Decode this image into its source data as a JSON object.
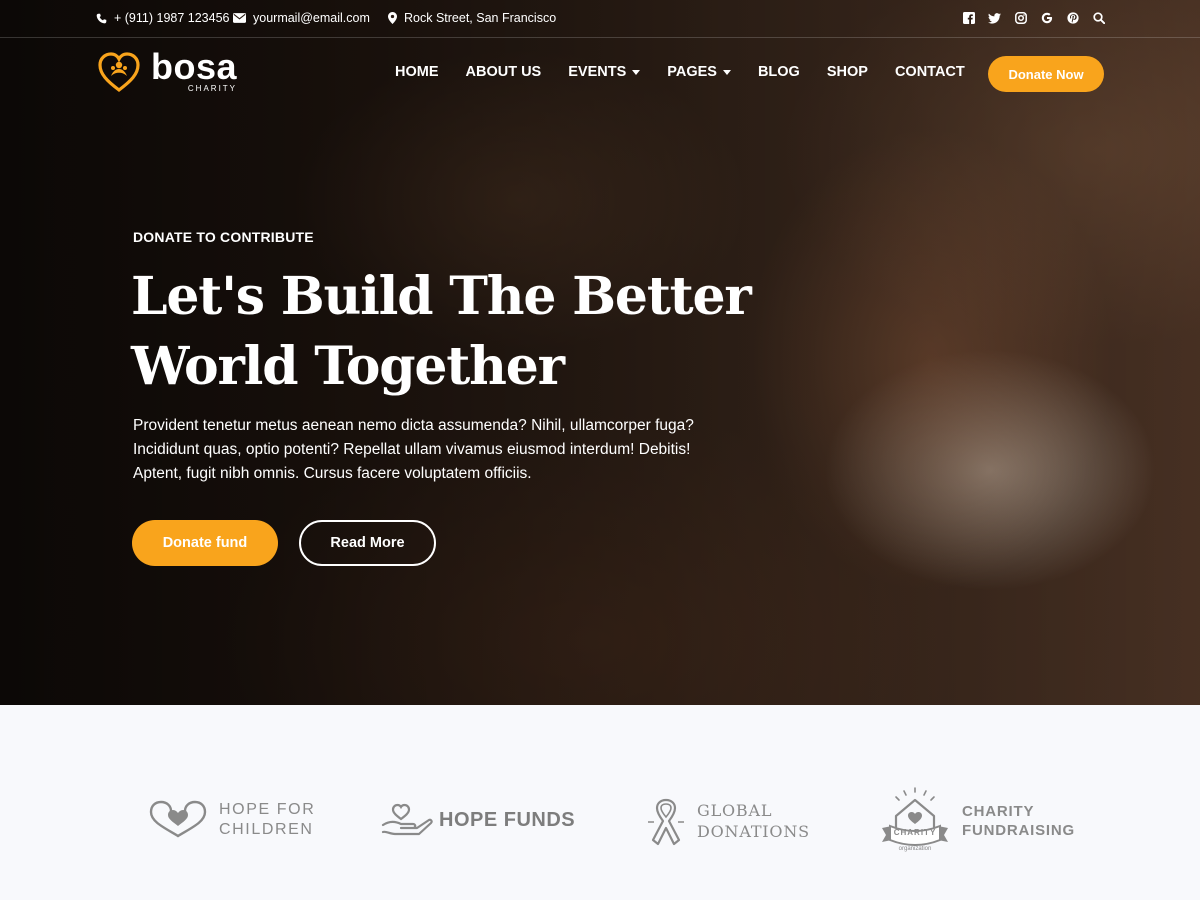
{
  "topbar": {
    "phone": "+ (911) 1987 123456",
    "email": "yourmail@email.com",
    "address": "Rock Street, San Francisco",
    "social": [
      "facebook-icon",
      "twitter-icon",
      "instagram-icon",
      "google-icon",
      "pinterest-icon",
      "search-icon"
    ]
  },
  "logo": {
    "name": "bosa",
    "tagline": "CHARITY"
  },
  "nav": {
    "items": [
      {
        "label": "HOME"
      },
      {
        "label": "ABOUT US"
      },
      {
        "label": "EVENTS"
      },
      {
        "label": "PAGES"
      },
      {
        "label": "BLOG"
      },
      {
        "label": "SHOP"
      },
      {
        "label": "CONTACT"
      }
    ],
    "cta": "Donate Now"
  },
  "hero": {
    "eyebrow": "DONATE TO CONTRIBUTE",
    "title_line1": "Let's Build The Better",
    "title_line2": "World Together",
    "desc_line1": "Provident tenetur metus aenean nemo dicta assumenda? Nihil, ullamcorper fuga?",
    "desc_line2": "Incididunt quas, optio potenti? Repellat ullam vivamus eiusmod interdum! Debitis!",
    "desc_line3": "Aptent, fugit nibh omnis. Cursus facere voluptatem officiis.",
    "primary_button": "Donate fund",
    "secondary_button": "Read More"
  },
  "partners": {
    "p1": {
      "line1": "HOPE FOR",
      "line2": "CHILDREN"
    },
    "p2": {
      "line1": "HOPE FUNDS"
    },
    "p3": {
      "line1": "GLOBAL",
      "line2": "DONATIONS"
    },
    "p4": {
      "line1": "CHARITY",
      "line2": "FUNDRAISING",
      "badge": "CHARITY",
      "sub": "organization"
    }
  },
  "colors": {
    "accent": "#f9a41c",
    "partner_gray": "#8a8a8a",
    "page_bg": "#f8f9fc"
  }
}
